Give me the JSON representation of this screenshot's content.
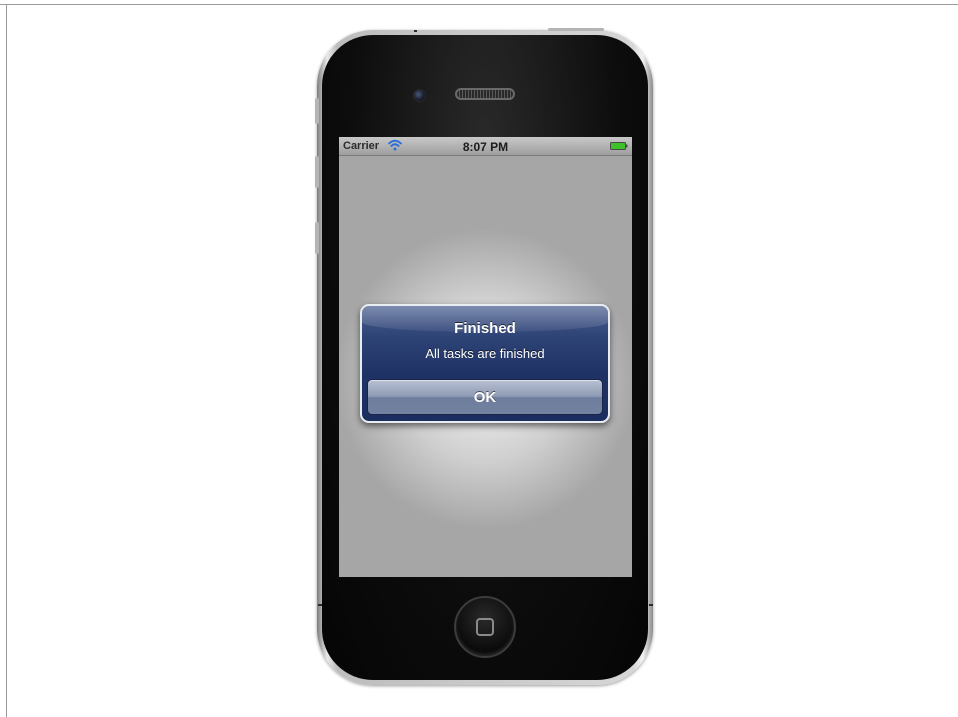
{
  "status_bar": {
    "carrier": "Carrier",
    "time": "8:07 PM",
    "wifi_icon": "wifi-icon",
    "battery_icon": "battery-icon",
    "battery_color": "#3ec22b"
  },
  "alert": {
    "title": "Finished",
    "message": "All tasks are finished",
    "button_label": "OK",
    "accent_color": "#1f3266"
  },
  "device": {
    "home_button_icon": "home-button-icon",
    "camera_icon": "camera-icon",
    "speaker_icon": "speaker-grille-icon"
  }
}
